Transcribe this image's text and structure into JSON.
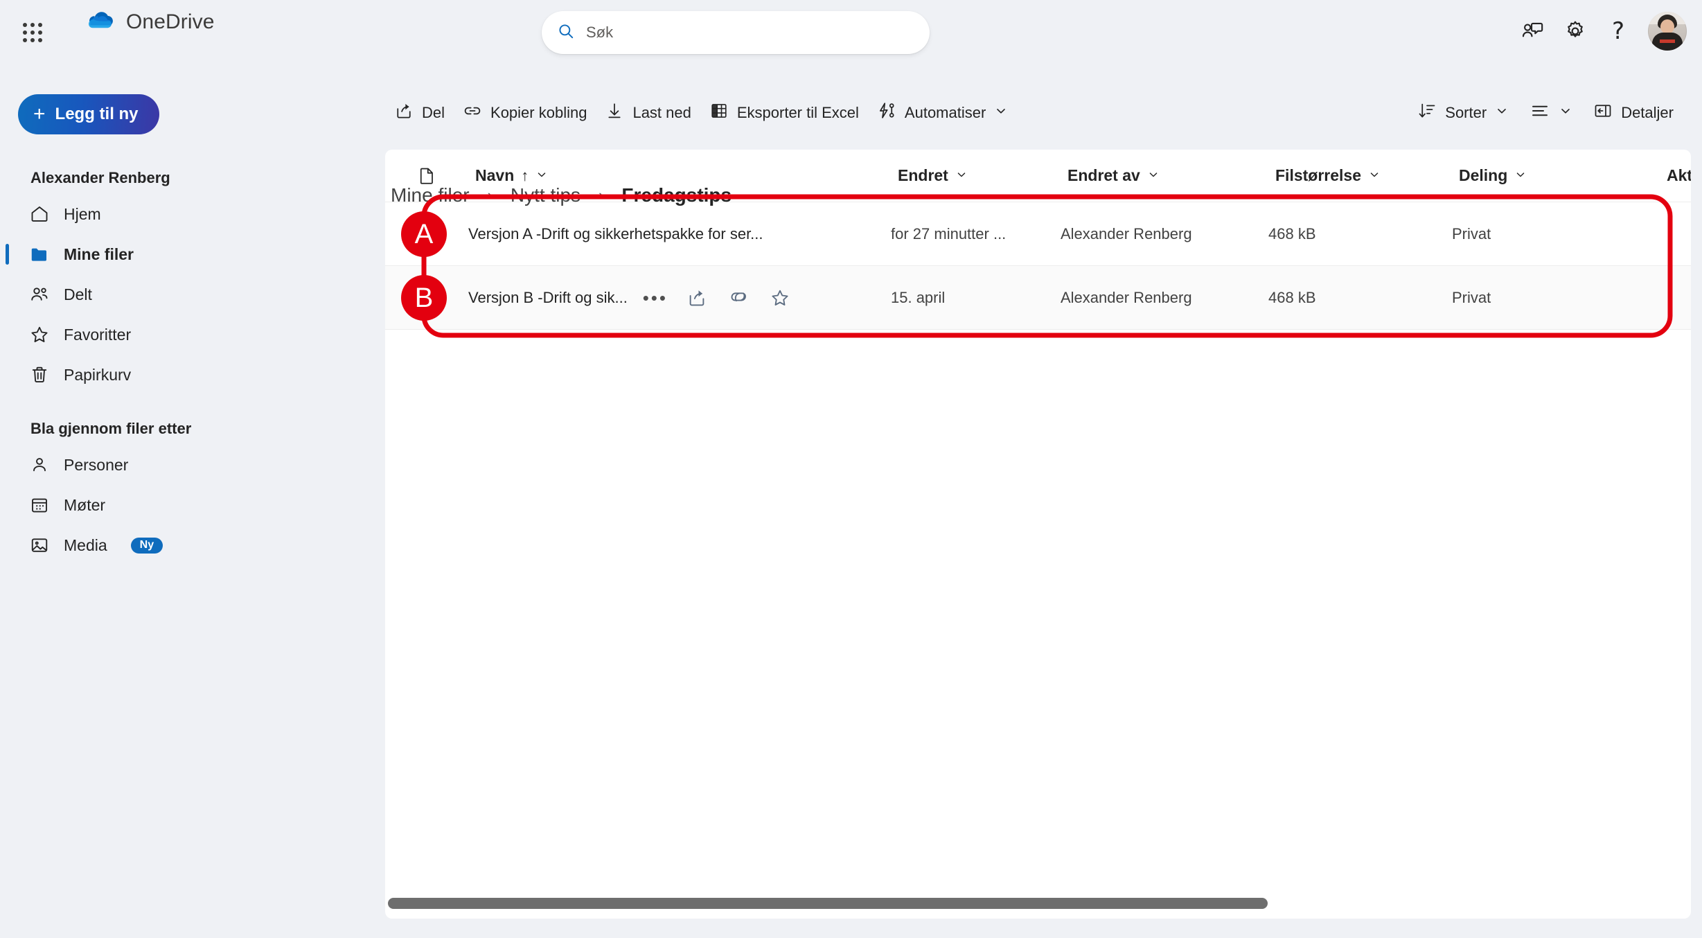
{
  "app": {
    "brand": "OneDrive",
    "waffle_icon": "app-launcher-waffle-icon",
    "cloud_icon": "onedrive-cloud-icon"
  },
  "search": {
    "placeholder": "Søk",
    "value": "",
    "icon": "search-icon"
  },
  "topright": {
    "feedback_icon": "person-feedback-icon",
    "settings_icon": "gear-icon",
    "help_icon": "question-mark-icon",
    "help_glyph": "?",
    "avatar": "user-avatar"
  },
  "commandbar": {
    "items": [
      {
        "label": "Del",
        "icon": "share-icon",
        "chevron": false
      },
      {
        "label": "Kopier kobling",
        "icon": "link-icon",
        "chevron": false
      },
      {
        "label": "Last ned",
        "icon": "download-arrow-icon",
        "chevron": false
      },
      {
        "label": "Eksporter til Excel",
        "icon": "excel-grid-icon",
        "chevron": false
      },
      {
        "label": "Automatiser",
        "icon": "automate-flow-icon",
        "chevron": true
      }
    ],
    "right": [
      {
        "label": "Sorter",
        "icon": "sort-icon",
        "chevron": true
      },
      {
        "label": "",
        "icon": "view-list-icon",
        "chevron": true
      },
      {
        "label": "Detaljer",
        "icon": "details-panel-icon",
        "chevron": false
      }
    ]
  },
  "sidebar": {
    "add_new_label": "Legg til ny",
    "add_new_icon": "plus-icon",
    "account_name": "Alexander Renberg",
    "items": [
      {
        "label": "Hjem",
        "icon": "home-icon",
        "selected": false
      },
      {
        "label": "Mine filer",
        "icon": "folder-icon",
        "selected": true
      },
      {
        "label": "Delt",
        "icon": "people-icon",
        "selected": false
      },
      {
        "label": "Favoritter",
        "icon": "star-icon",
        "selected": false
      },
      {
        "label": "Papirkurv",
        "icon": "trash-icon",
        "selected": false
      }
    ],
    "browse_section_title": "Bla gjennom filer etter",
    "browse_items": [
      {
        "label": "Personer",
        "icon": "person-icon",
        "badge": ""
      },
      {
        "label": "Møter",
        "icon": "calendar-icon",
        "badge": ""
      },
      {
        "label": "Media",
        "icon": "image-icon",
        "badge": "Ny"
      }
    ]
  },
  "breadcrumb": {
    "separator": "›",
    "items": [
      {
        "label": "Mine filer",
        "current": false
      },
      {
        "label": "Nytt tips",
        "current": false
      },
      {
        "label": "Fredagstips",
        "current": true
      }
    ]
  },
  "filelist": {
    "columns": [
      {
        "key": "icon",
        "label": "",
        "icon": "file-type-icon",
        "sort": "",
        "chevron": false
      },
      {
        "key": "name",
        "label": "Navn",
        "sort": "↑",
        "chevron": true
      },
      {
        "key": "mod",
        "label": "Endret",
        "sort": "",
        "chevron": true
      },
      {
        "key": "modby",
        "label": "Endret av",
        "sort": "",
        "chevron": true
      },
      {
        "key": "size",
        "label": "Filstørrelse",
        "sort": "",
        "chevron": true
      },
      {
        "key": "share",
        "label": "Deling",
        "sort": "",
        "chevron": true
      },
      {
        "key": "act",
        "label": "Akti",
        "sort": "",
        "chevron": false
      }
    ],
    "rows": [
      {
        "file_icon": "word-document-icon",
        "name": "Versjon A -Drift og sikkerhetspakke for ser...",
        "modified": "for 27 minutter ...",
        "modified_by": "Alexander Renberg",
        "size": "468 kB",
        "sharing": "Privat",
        "hovered": false,
        "actions": []
      },
      {
        "file_icon": "word-document-icon",
        "name": "Versjon B -Drift og sik...",
        "modified": "15. april",
        "modified_by": "Alexander Renberg",
        "size": "468 kB",
        "sharing": "Privat",
        "hovered": true,
        "actions": [
          {
            "icon": "more-options-icon",
            "glyph": "•••"
          },
          {
            "icon": "share-icon",
            "glyph": ""
          },
          {
            "icon": "copilot-icon",
            "glyph": ""
          },
          {
            "icon": "favorite-star-icon",
            "glyph": ""
          }
        ]
      }
    ]
  },
  "annotation": {
    "color": "#e3000f",
    "badges": [
      {
        "label": "A",
        "row": 0
      },
      {
        "label": "B",
        "row": 1
      }
    ]
  },
  "scrollbar": {
    "orientation": "horizontal",
    "thumb_color": "#6e6e6e"
  },
  "colors": {
    "accent": "#0f6cbd",
    "annotation_red": "#e3000f",
    "page_bg": "#eff1f5",
    "panel_bg": "#ffffff",
    "word_blue": "#185abd"
  }
}
